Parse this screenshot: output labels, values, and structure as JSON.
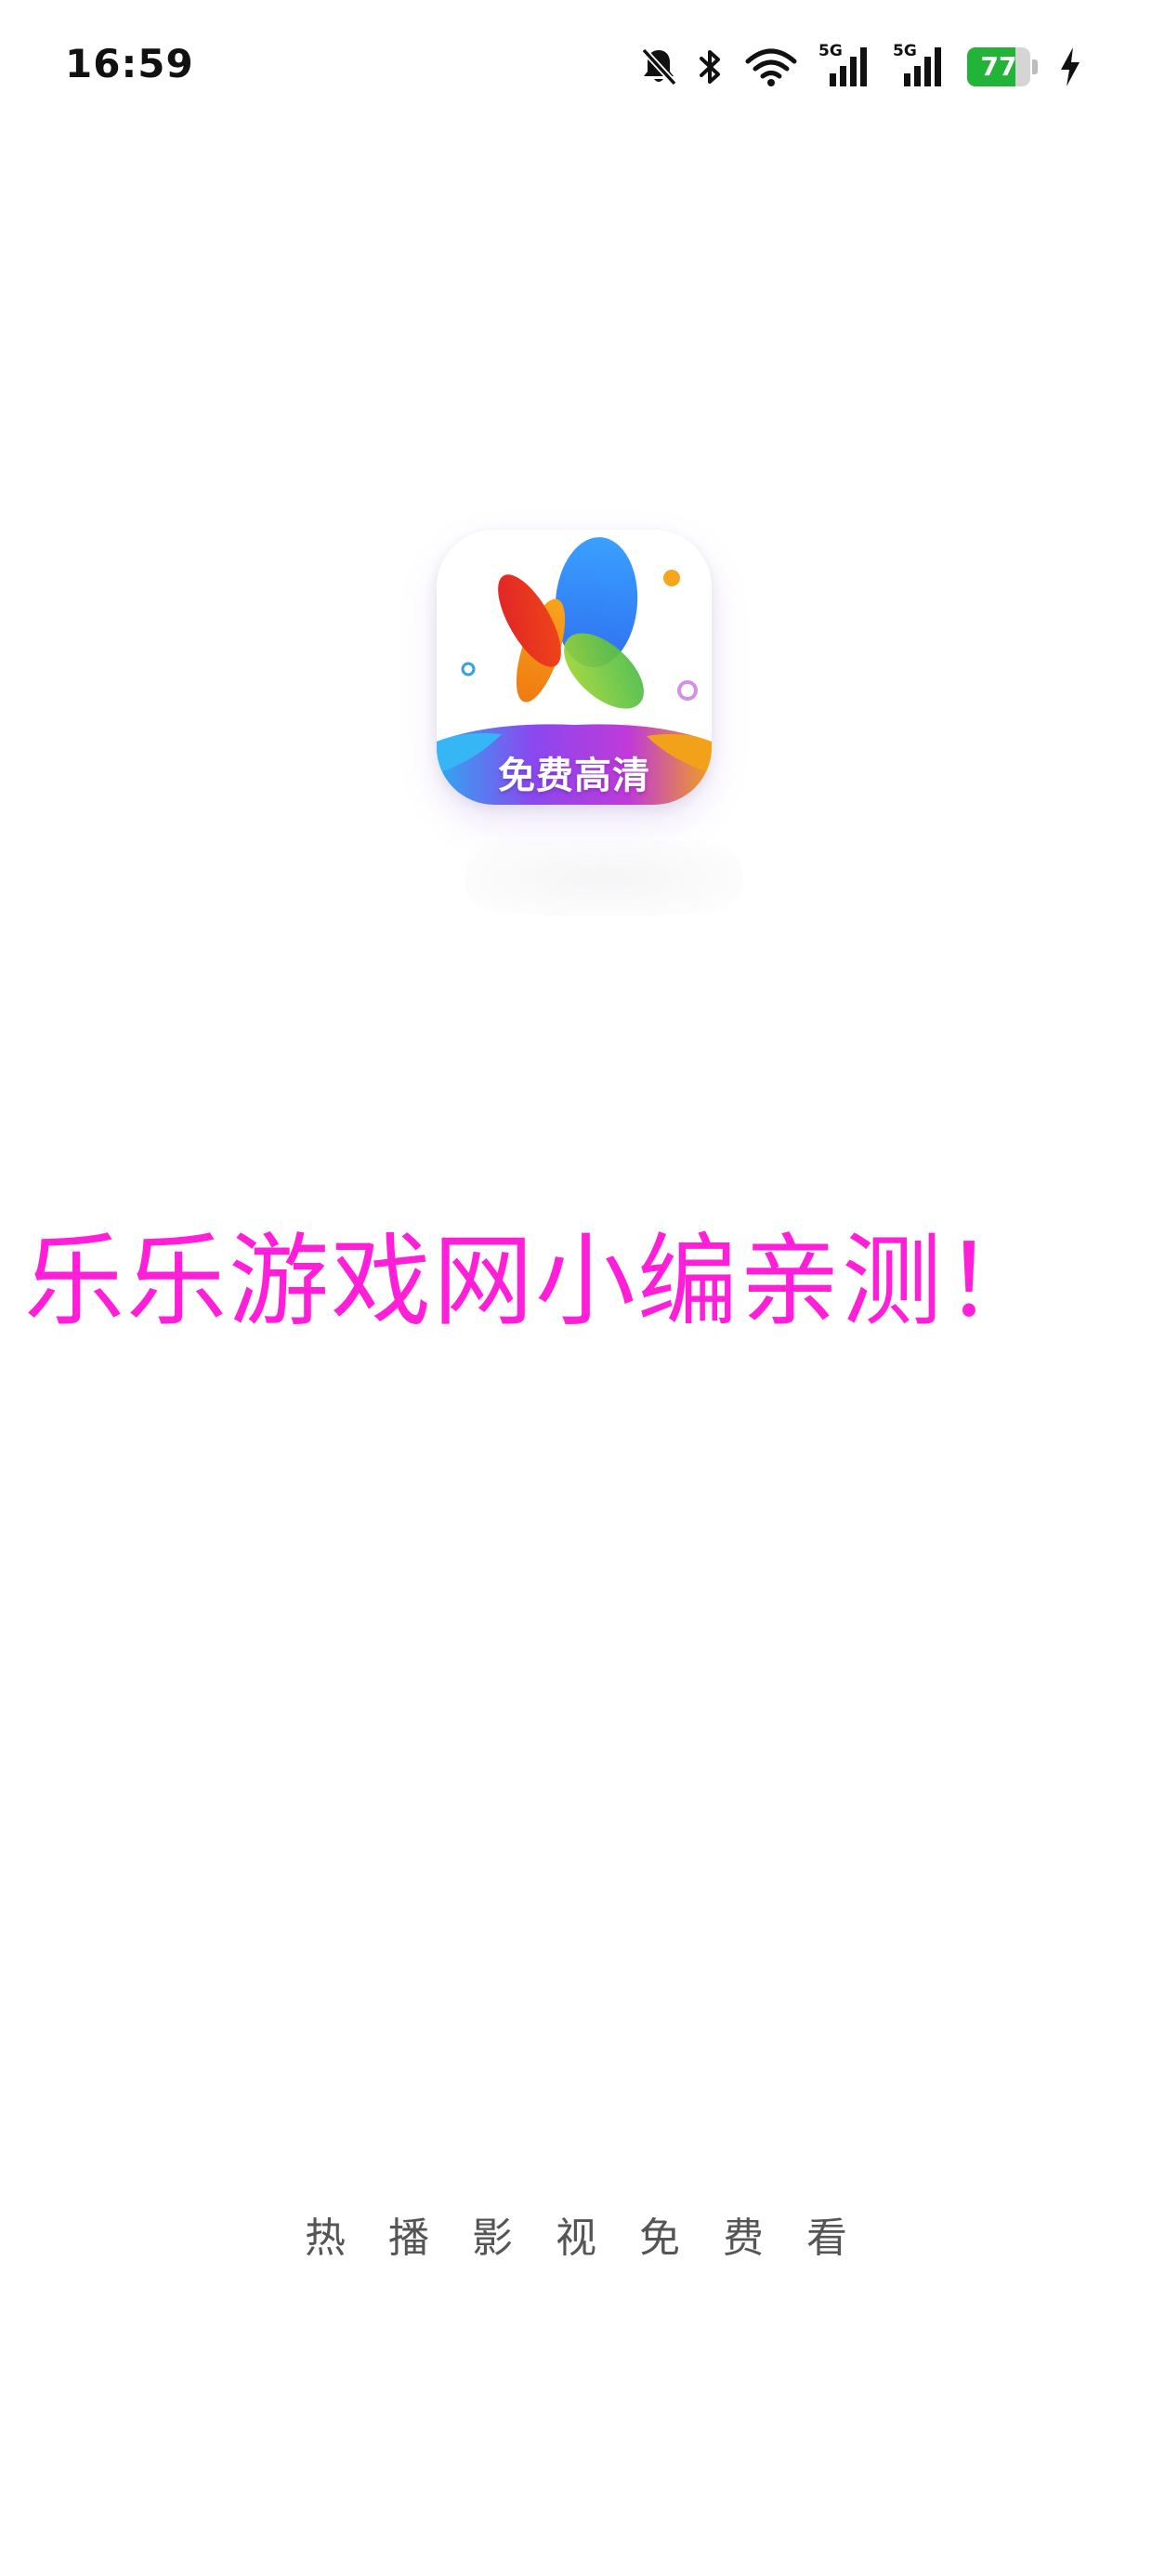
{
  "status_bar": {
    "time": "16:59",
    "icons": [
      "bell-muted-icon",
      "bluetooth-icon",
      "wifi-icon",
      "signal-5g-icon",
      "signal-5g-icon",
      "battery-icon",
      "charging-bolt-icon"
    ],
    "signal_1_label": "5G",
    "signal_2_label": "5G",
    "battery_level": "77",
    "battery_fraction": 0.77,
    "battery_color": "#22b438"
  },
  "app": {
    "icon_label": "免费高清",
    "tagline": "热播影视免费看"
  },
  "watermark": {
    "text": "乐乐游戏网小编亲测！",
    "color": "#ff1fd8"
  }
}
